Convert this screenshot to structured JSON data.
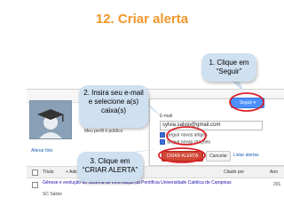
{
  "slide": {
    "title": "12. Criar alerta"
  },
  "callouts": {
    "c1": "1. Clique em\n“Seguir”",
    "c2": "2. Insira seu e-mail\ne selecione a(s)\ncaixa(s)",
    "c3": "3. Clique em\n“CRIAR ALERTA”"
  },
  "profile": {
    "avatar_link": "Alterar foto",
    "meu_perfil": "Meu perfil é público"
  },
  "follow_panel": {
    "seguir_label": "Seguir ▾",
    "email_label": "E-mail",
    "email_value": "sylvia.salvio@gmail.com",
    "option_1": "Seguir novos artigos",
    "option_2": "Seguir novas citações",
    "criar_label": "CRIAR ALERTA",
    "cancelar_label": "Cancelar",
    "listar_label": "Listar alertas"
  },
  "table": {
    "col_titulo": "Título",
    "col_adicionar": "+ Adicionar",
    "col_citado": "Citado por",
    "col_ano": "Ano"
  },
  "article": {
    "title": "Gênese e evolução do Sistema de Informação da Pontifícia Universidade Católica de Campinas",
    "author": "SC Salvio",
    "year": "201"
  },
  "colors": {
    "title": "#f0962a",
    "callout_bg": "#cfe0f0",
    "circle": "#d9232a",
    "seguir_btn": "#4d90fe",
    "criar_btn": "#d14836"
  }
}
